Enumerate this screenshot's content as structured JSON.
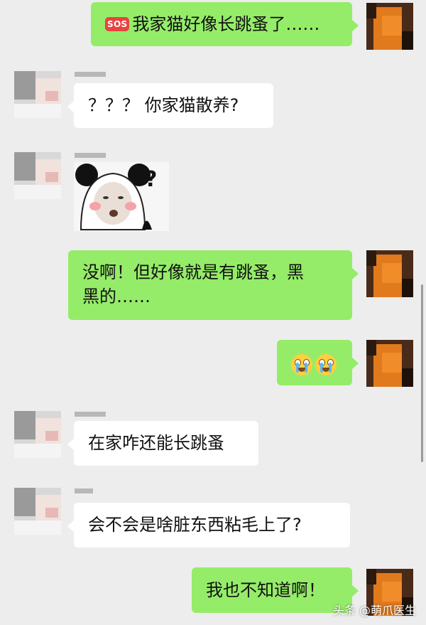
{
  "messages": [
    {
      "sender": "me",
      "badge": "SOS",
      "text": "我家猫好像长跳蚤了……"
    },
    {
      "sender": "friend",
      "text": "？？？ 你家猫散养?"
    },
    {
      "sender": "friend",
      "sticker": "panda-meme-sticker",
      "sticker_mark": "?"
    },
    {
      "sender": "me",
      "line1": "没啊！但好像就是有跳蚤，黑",
      "line2": "黑的……"
    },
    {
      "sender": "me",
      "emoji": [
        "crying-face-emoji",
        "crying-face-emoji"
      ]
    },
    {
      "sender": "friend",
      "text": "在家咋还能长跳蚤"
    },
    {
      "sender": "friend",
      "text": "会不会是啥脏东西粘毛上了?"
    },
    {
      "sender": "me",
      "text": "我也不知道啊！"
    }
  ],
  "watermark": "头条 @萌爪医生",
  "colors": {
    "background": "#ededed",
    "my_bubble": "#95ec69",
    "friend_bubble": "#ffffff"
  }
}
